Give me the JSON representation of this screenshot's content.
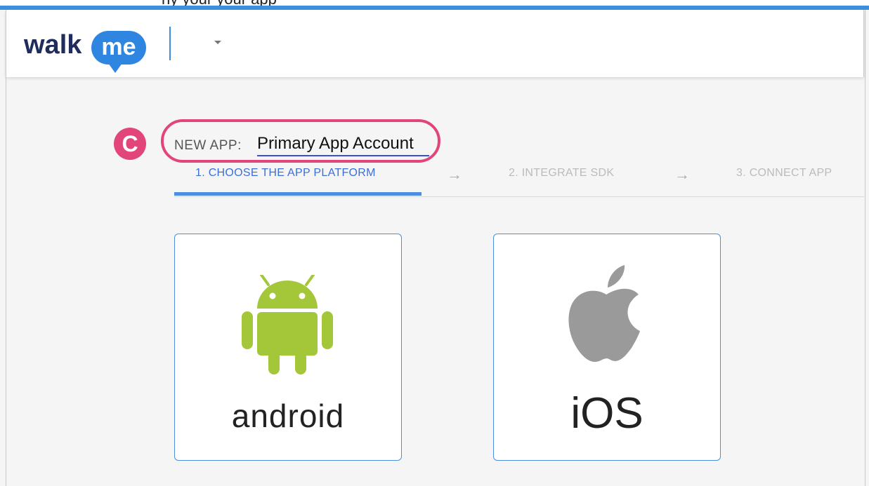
{
  "header": {
    "logo_text_left": "walk",
    "logo_text_right": "me",
    "partial_top_text": "ny   your                                            your  app"
  },
  "annotation": {
    "badge_letter": "C"
  },
  "app": {
    "label": "NEW APP:",
    "name_value": "Primary App Account"
  },
  "steps": [
    {
      "label": "1. CHOOSE THE APP PLATFORM",
      "state": "active"
    },
    {
      "label": "2. INTEGRATE SDK",
      "state": "inactive"
    },
    {
      "label": "3. CONNECT APP",
      "state": "inactive"
    }
  ],
  "arrows": [
    "→",
    "→"
  ],
  "platforms": [
    {
      "label": "android",
      "icon": "android-robot-icon",
      "color": "#a4c639"
    },
    {
      "label": "iOS",
      "icon": "apple-icon",
      "color": "#9a9a9a"
    }
  ],
  "colors": {
    "accent": "#3b8fdd",
    "active_step": "#3c6fd6",
    "highlight": "#e2457a",
    "brand_blue": "#2f86e0"
  }
}
